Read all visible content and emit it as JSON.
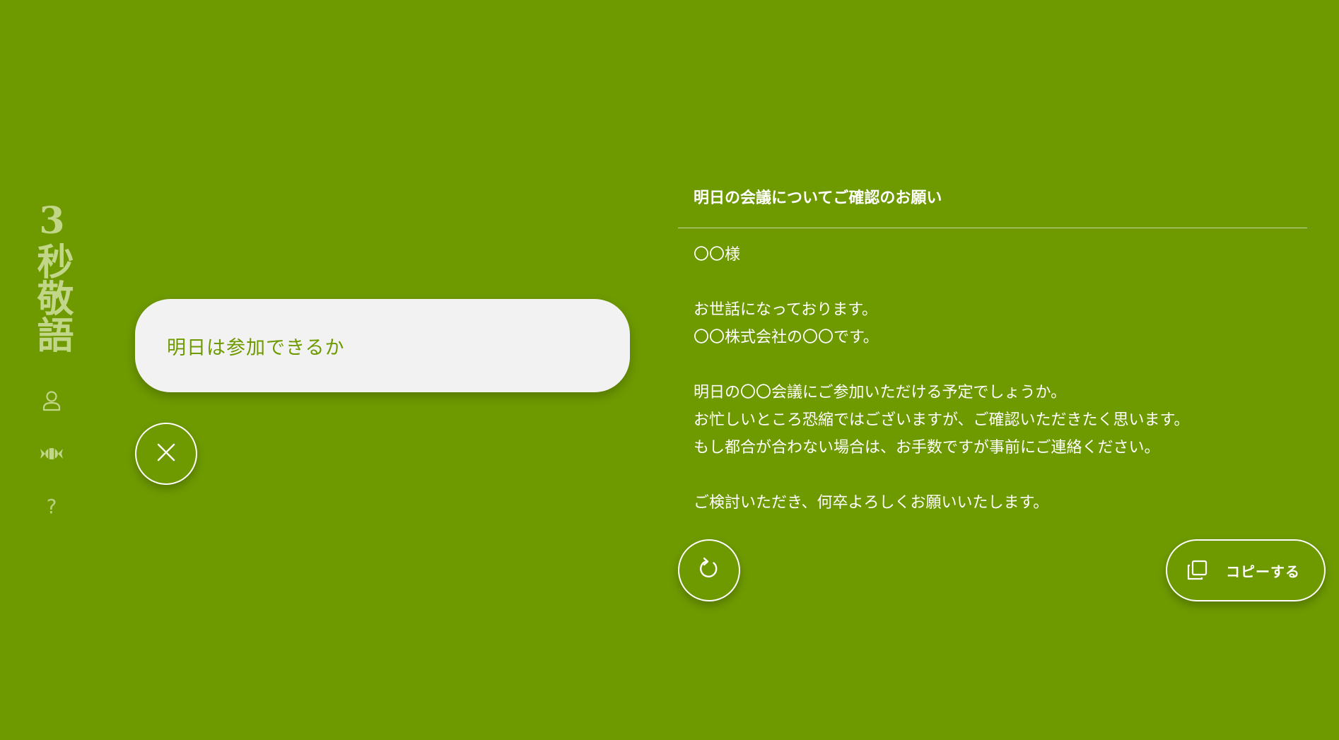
{
  "app": {
    "logo_text": "3秒敬語"
  },
  "sidebar": {
    "items": [
      {
        "icon": "user-icon"
      },
      {
        "icon": "candy-icon"
      },
      {
        "icon": "help-icon",
        "glyph": "?"
      }
    ]
  },
  "input": {
    "value": "明日は参加できるか"
  },
  "clear_button": {
    "icon": "close-icon"
  },
  "result": {
    "subject": "明日の会議についてご確認のお願い",
    "lines": [
      "〇〇様",
      "",
      "お世話になっております。",
      "〇〇株式会社の〇〇です。",
      "",
      "明日の〇〇会議にご参加いただける予定でしょうか。",
      "お忙しいところ恐縮ではございますが、ご確認いただきたく思います。",
      "もし都合が合わない場合は、お手数ですが事前にご連絡ください。",
      "",
      "ご検討いただき、何卒よろしくお願いいたします。"
    ]
  },
  "actions": {
    "regenerate_icon": "refresh-icon",
    "copy_icon": "copy-icon",
    "copy_label": "コピーする"
  },
  "colors": {
    "background": "#6e9a00",
    "input_bg": "#f2f2f2",
    "accent_text": "#6e9a00",
    "muted": "#c2d68a"
  }
}
